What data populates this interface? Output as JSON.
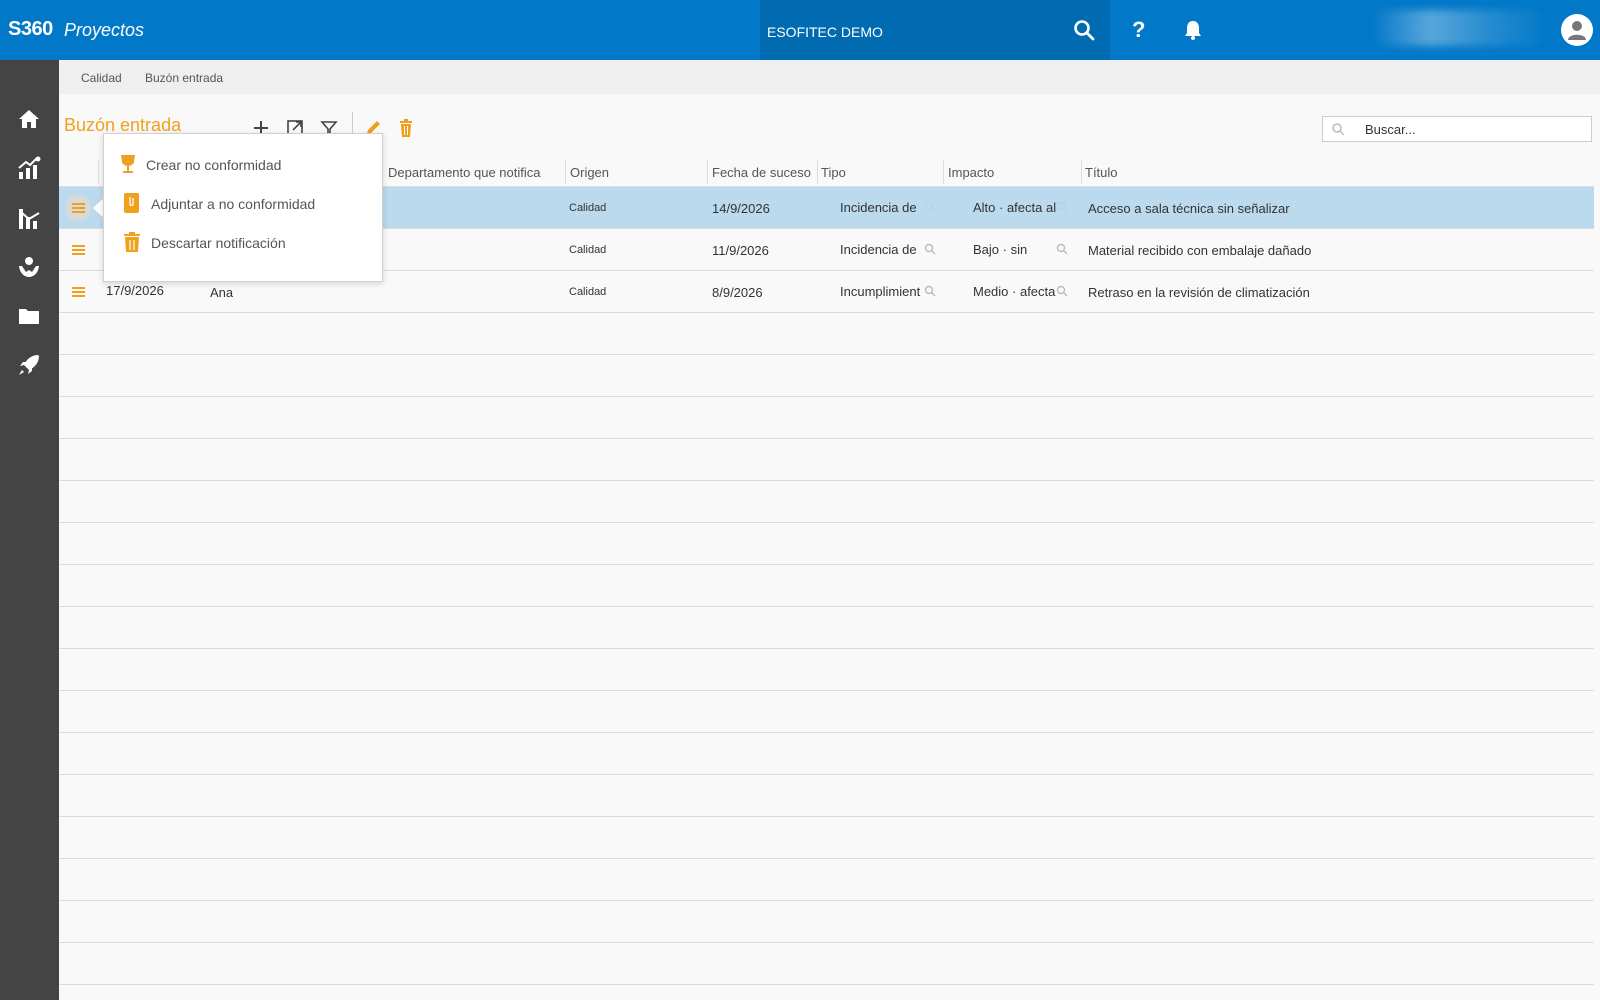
{
  "header": {
    "brand": "S360",
    "app_name": "Proyectos",
    "company": "ESOFITEC DEMO",
    "help_label": "?"
  },
  "sidebar": {
    "items": [
      "home-icon",
      "analytics-icon",
      "chart-icon",
      "care-icon",
      "folder-icon",
      "rocket-icon"
    ]
  },
  "breadcrumb": [
    "Calidad",
    "Buzón entrada"
  ],
  "toolbar": {
    "title": "Buzón entrada",
    "search_placeholder": "Buscar..."
  },
  "table": {
    "columns": [
      "Departamento que notifica",
      "Origen",
      "Fecha de suceso",
      "Tipo",
      "Impacto",
      "Título"
    ],
    "rows": [
      {
        "fecha_alta": "",
        "notificador": "",
        "origen": "Calidad",
        "fecha_suceso": "14/9/2026",
        "tipo": "Incidencia de",
        "impacto": "Alto · afecta al",
        "titulo": "Acceso a sala técnica sin señalizar",
        "selected": true
      },
      {
        "fecha_alta": "",
        "notificador": "",
        "origen": "Calidad",
        "fecha_suceso": "11/9/2026",
        "tipo": "Incidencia de",
        "impacto": "Bajo · sin",
        "titulo": "Material recibido con embalaje dañado",
        "selected": false
      },
      {
        "fecha_alta": "17/9/2026",
        "notificador": "Ana",
        "origen": "Calidad",
        "fecha_suceso": "8/9/2026",
        "tipo": "Incumplimient",
        "impacto": "Medio · afecta",
        "titulo": "Retraso en la revisión de climatización",
        "selected": false
      }
    ]
  },
  "context_menu": {
    "items": [
      "Crear no conformidad",
      "Adjuntar a no conformidad",
      "Descartar notificación"
    ]
  },
  "colors": {
    "topbar": "#0178c8",
    "accent": "#f0a01c",
    "sidebar": "#444444",
    "selected_row": "#bcdaee"
  }
}
